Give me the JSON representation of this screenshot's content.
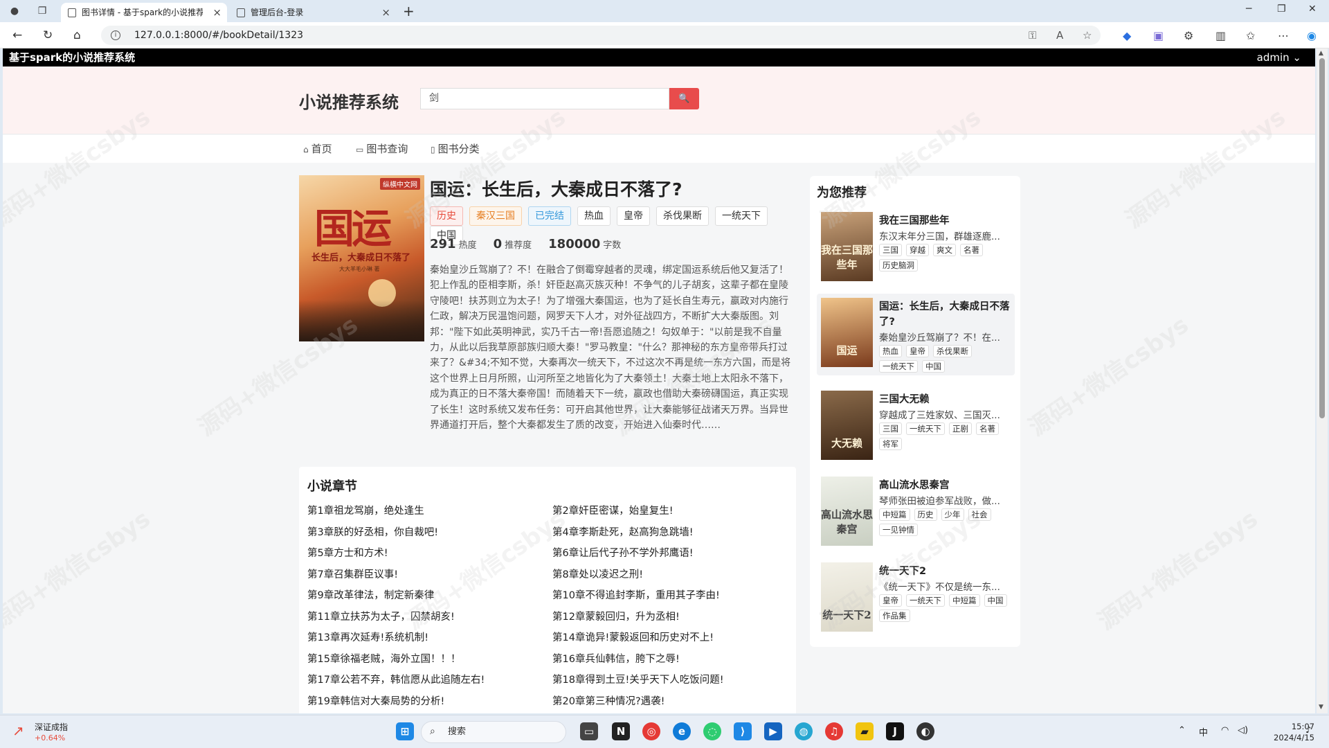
{
  "browser": {
    "tabs": [
      {
        "title": "图书详情 - 基于spark的小说推荐",
        "active": true
      },
      {
        "title": "管理后台-登录",
        "active": false
      }
    ],
    "url": "127.0.0.1:8000/#/bookDetail/1323"
  },
  "appbar": {
    "name": "基于spark的小说推荐系统",
    "user": "admin ⌄"
  },
  "header": {
    "site_title": "小说推荐系统",
    "search_value": "剑",
    "search_icon": "search-icon"
  },
  "nav": {
    "items": [
      {
        "label": "首页",
        "icon": "home-icon"
      },
      {
        "label": "图书查询",
        "icon": "book-icon"
      },
      {
        "label": "图书分类",
        "icon": "clipboard-icon"
      }
    ]
  },
  "book": {
    "title": "国运：长生后，大秦成日不落了?",
    "cover_text": {
      "badge": "纵横中文网",
      "big": "国运",
      "sub": "长生后，大秦成日不落了",
      "author": "大大羊毛小琳 著"
    },
    "tags": [
      {
        "label": "历史",
        "style": "red"
      },
      {
        "label": "秦汉三国",
        "style": "orange"
      },
      {
        "label": "已完结",
        "style": "blue"
      },
      {
        "label": "热血",
        "style": ""
      },
      {
        "label": "皇帝",
        "style": ""
      },
      {
        "label": "杀伐果断",
        "style": ""
      },
      {
        "label": "一统天下",
        "style": ""
      },
      {
        "label": "中国",
        "style": ""
      }
    ],
    "stats": [
      {
        "value": "291",
        "label": "热度"
      },
      {
        "value": "0",
        "label": "推荐度"
      },
      {
        "value": "180000",
        "label": "字数"
      }
    ],
    "description": "秦始皇沙丘驾崩了？不！在融合了倒霉穿越者的灵魂，绑定国运系统后他又复活了！犯上作乱的臣相李斯，杀！奸臣赵高灭族灭种！不争气的儿子胡亥，这辈子都在皇陵守陵吧！扶苏则立为太子！为了增强大秦国运，也为了延长自生寿元，嬴政对内施行仁政，解决万民温饱问题，网罗天下人才，对外征战四方，不断扩大大秦版图。刘邦：\"陛下如此英明神武，实乃千古一帝!吾愿追随之！勾奴单于：\"以前是我不自量力，从此以后我草原部族归顺大秦！\"罗马教皇：\"什么？那神秘的东方皇帝带兵打过来了？&#34;不知不觉，大秦再次一统天下，不过这次不再是统一东方六国，而是将这个世界上日月所照，山河所至之地皆化为了大秦领土！大秦土地上太阳永不落下，成为真正的日不落大秦帝国！而随着天下一统，嬴政也借助大秦磅礴国运，真正实现了长生！这时系统又发布任务：可开启其他世界，让大秦能够征战诸天万界。当异世界通道打开后，整个大秦都发生了质的改变，开始进入仙秦时代……"
  },
  "chapters": {
    "title": "小说章节",
    "items": [
      "第1章祖龙驾崩，绝处逢生",
      "第2章奸臣密谋，始皇复生!",
      "第3章朕的好丞相，你自裁吧!",
      "第4章李斯赴死，赵高狗急跳墙!",
      "第5章方士和方术!",
      "第6章让后代子孙不学外邦鹰语!",
      "第7章召集群臣议事!",
      "第8章处以凌迟之刑!",
      "第9章改革律法，制定新秦律",
      "第10章不得追封李斯，重用其子李由!",
      "第11章立扶苏为太子，囚禁胡亥!",
      "第12章蒙毅回归，升为丞相!",
      "第13章再次延寿!系统机制!",
      "第14章诡异!蒙毅返回和历史对不上!",
      "第15章徐福老贼，海外立国！！！",
      "第16章兵仙韩信，胯下之辱!",
      "第17章公若不弃，韩信愿从此追随左右!",
      "第18章得到土豆!关乎天下人吃饭问题!",
      "第19章韩信对大秦局势的分析!",
      "第20章第三种情况?遇袭!"
    ]
  },
  "recommend": {
    "title": "为您推荐",
    "items": [
      {
        "name": "我在三国那些年",
        "desc": "东汉末年分三国，群雄逐鹿...",
        "tags": [
          "三国",
          "穿越",
          "爽文",
          "名著",
          "历史脑洞"
        ],
        "cover_text": "我在三国那些年",
        "cover_colors": [
          "#c9a27a",
          "#5a3a22"
        ]
      },
      {
        "name": "国运：长生后，大秦成日不落了?",
        "desc": "秦始皇沙丘驾崩了？不！在...",
        "tags": [
          "热血",
          "皇帝",
          "杀伐果断",
          "一统天下",
          "中国"
        ],
        "cover_text": "国运",
        "cover_colors": [
          "#f0c48a",
          "#7a3a1c"
        ]
      },
      {
        "name": "三国大无赖",
        "desc": "穿越成了三姓家奴、三国灭...",
        "tags": [
          "三国",
          "一统天下",
          "正剧",
          "名著",
          "将军"
        ],
        "cover_text": "大无赖",
        "cover_colors": [
          "#8a6a4a",
          "#3a2414"
        ]
      },
      {
        "name": "高山流水思秦宫",
        "desc": "琴师张田被迫参军战败，做...",
        "tags": [
          "中短篇",
          "历史",
          "少年",
          "社会",
          "一见钟情"
        ],
        "cover_text": "高山流水思秦宫",
        "cover_colors": [
          "#eef0e8",
          "#c9cfc2"
        ]
      },
      {
        "name": "统一天下2",
        "desc": "《统一天下》不仅是统一东...",
        "tags": [
          "皇帝",
          "一统天下",
          "中短篇",
          "中国",
          "作品集"
        ],
        "cover_text": "统一天下2",
        "cover_colors": [
          "#f3f1e8",
          "#dcd8c8"
        ]
      }
    ]
  },
  "taskbar": {
    "stock_name": "深证成指",
    "stock_change": "+0.64%",
    "search_placeholder": "搜索",
    "ime": "中",
    "time": "15:07",
    "date": "2024/4/15"
  },
  "colors": {
    "accent": "#e84c4c",
    "appbar": "#000000",
    "header_bg": "#fdf2f2"
  }
}
